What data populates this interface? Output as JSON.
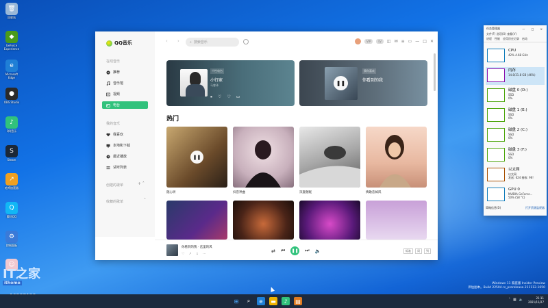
{
  "desktop": {
    "icons": [
      {
        "label": "回收站",
        "color": "#9ab8d8",
        "glyph": "🗑"
      },
      {
        "label": "GeForce Experience",
        "color": "#4a9a1a",
        "glyph": "◆"
      },
      {
        "label": "Microsoft Edge",
        "color": "#1f7fd6",
        "glyph": "e"
      },
      {
        "label": "OBS Studio",
        "color": "#2a2a2a",
        "glyph": "●"
      },
      {
        "label": "QQ音乐",
        "color": "#31c27c",
        "glyph": "♪"
      },
      {
        "label": "Steam",
        "color": "#1b2838",
        "glyph": "S"
      },
      {
        "label": "吃鸡加速器",
        "color": "#f0a020",
        "glyph": "↗"
      },
      {
        "label": "腾讯QQ",
        "color": "#12b7f5",
        "glyph": "Q"
      },
      {
        "label": "控制面板",
        "color": "#3a7ad8",
        "glyph": "⚙"
      },
      {
        "label": "",
        "color": "#f1c8d0",
        "glyph": "☺"
      }
    ],
    "watermark_text": "IT之家",
    "watermark_small": "ithome",
    "counter": "10287122"
  },
  "qq": {
    "app_name": "QQ音乐",
    "sidebar": {
      "section_online": "在线音乐",
      "items": [
        {
          "label": "推荐",
          "icon": "disc-icon"
        },
        {
          "label": "音乐馆",
          "icon": "note-icon"
        },
        {
          "label": "视频",
          "icon": "video-icon"
        },
        {
          "label": "电台",
          "icon": "radio-icon"
        }
      ],
      "section_mine": "我的音乐",
      "mine_items": [
        {
          "label": "我喜欢",
          "icon": "heart-icon"
        },
        {
          "label": "本地和下载",
          "icon": "monitor-icon"
        },
        {
          "label": "最近播放",
          "icon": "clock-icon"
        },
        {
          "label": "试听列表",
          "icon": "list-icon"
        }
      ],
      "section_created": "创建的歌单",
      "section_collected": "收藏的歌单"
    },
    "search_placeholder": "搜索音乐",
    "banners": [
      {
        "tag": "个性电台",
        "title": "小行家",
        "subtitle": "马睿泽"
      },
      {
        "tag": "猜你喜欢",
        "title": "你看到的我"
      }
    ],
    "hot_title": "热门",
    "cards": [
      {
        "label": "随心听"
      },
      {
        "label": "抖音神曲"
      },
      {
        "label": "深度催眠"
      },
      {
        "label": "情歌恋如风"
      }
    ],
    "player": {
      "title": "你看到的我 · 这里的风",
      "btn_a": "标准",
      "btn_b": "词",
      "btn_c": "列"
    }
  },
  "taskmgr": {
    "title": "任务管理器",
    "menu": "文件(F)  选项(O)  查看(V)",
    "tabs": [
      "进程",
      "性能",
      "应用历史记录",
      "启动"
    ],
    "rows": [
      {
        "name": "CPU",
        "l2": "42% 4.68 GHz",
        "l3": "",
        "color": "#117dbb"
      },
      {
        "name": "内存",
        "l2": "14.8/31.8 GB (46%)",
        "l3": "",
        "color": "#8b12ae"
      },
      {
        "name": "磁盘 0 (D:)",
        "l2": "SSD",
        "l3": "0%",
        "color": "#4da60c"
      },
      {
        "name": "磁盘 1 (E:)",
        "l2": "SSD",
        "l3": "0%",
        "color": "#4da60c"
      },
      {
        "name": "磁盘 2 (C:)",
        "l2": "SSD",
        "l3": "0%",
        "color": "#4da60c"
      },
      {
        "name": "磁盘 3 (F:)",
        "l2": "SSD",
        "l3": "0%",
        "color": "#4da60c"
      },
      {
        "name": "以太网",
        "l2": "以太网",
        "l3": "发送: 624  接收: 96!",
        "color": "#a74f01"
      },
      {
        "name": "GPU 0",
        "l2": "NVIDIA GeForce...",
        "l3": "50% (58 °C)",
        "color": "#117dbb"
      }
    ],
    "fewer_details": "简略信息(D)",
    "open_monitor": "打开资源监视器"
  },
  "build": {
    "line1": "Windows 11 家庭版 Insider Preview",
    "line2": "评估副本。Build 22504.rs_prerelease.211112-1650"
  },
  "taskbar": {
    "time": "21:11",
    "date": "2021/11/27"
  }
}
